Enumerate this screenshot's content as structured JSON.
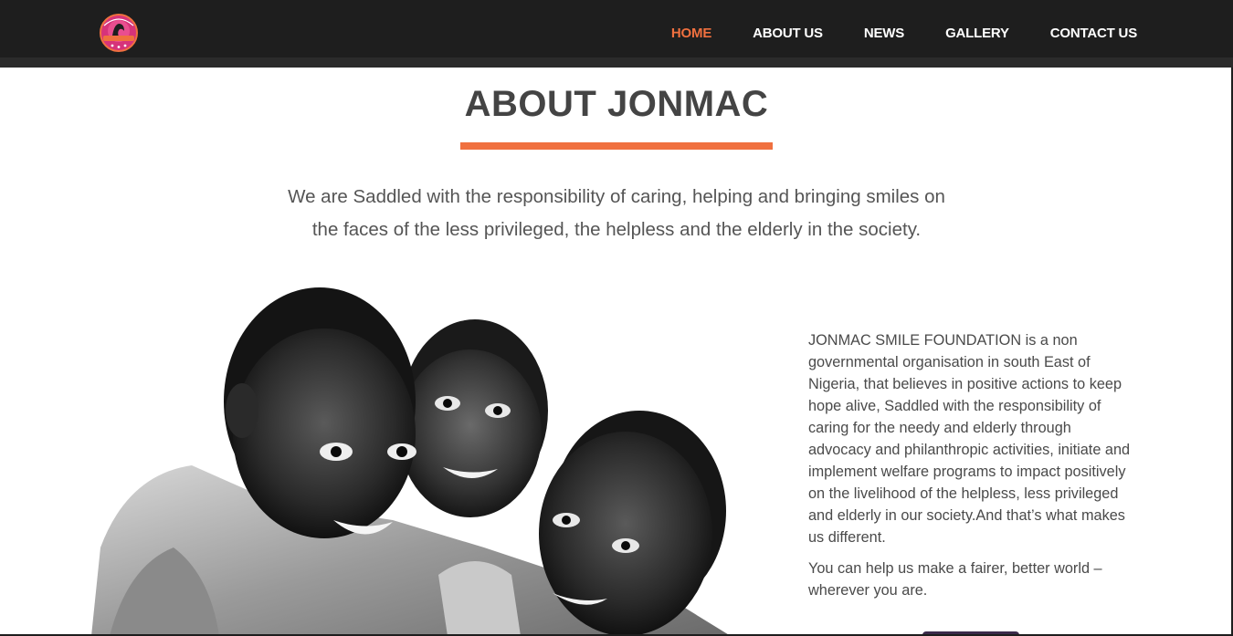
{
  "header": {
    "logo_alt": "JONMAC SMILE FOUNDATION",
    "logo_icon": "foundation-logo-icon",
    "brand_colors": {
      "bar": "#1e1e1e",
      "accent": "#f0703f",
      "logo_pink": "#d6337a"
    }
  },
  "nav": {
    "items": [
      {
        "label": "HOME",
        "active": true
      },
      {
        "label": "ABOUT US",
        "active": false
      },
      {
        "label": "NEWS",
        "active": false
      },
      {
        "label": "GALLERY",
        "active": false
      },
      {
        "label": "CONTACT US",
        "active": false
      }
    ]
  },
  "about": {
    "title": "ABOUT JONMAC",
    "intro_line1": "We are Saddled with the responsibility of caring, helping and bringing smiles on",
    "intro_line2": "the faces of the less privileged, the helpless and the elderly in the society.",
    "paragraph1": "JONMAC SMILE FOUNDATION is a  non governmental organisation in south East of Nigeria, that believes in positive actions to keep hope alive, Saddled with the responsibility of caring for the needy and elderly through advocacy and philanthropic activities, initiate and implement welfare programs to impact positively on the livelihood of the helpless, less privileged and elderly in our society.And that’s what makes us different.",
    "paragraph2": "You can help us make a fairer, better world – wherever you are.",
    "photo_alt": "Three smiling children, black and white photo"
  }
}
